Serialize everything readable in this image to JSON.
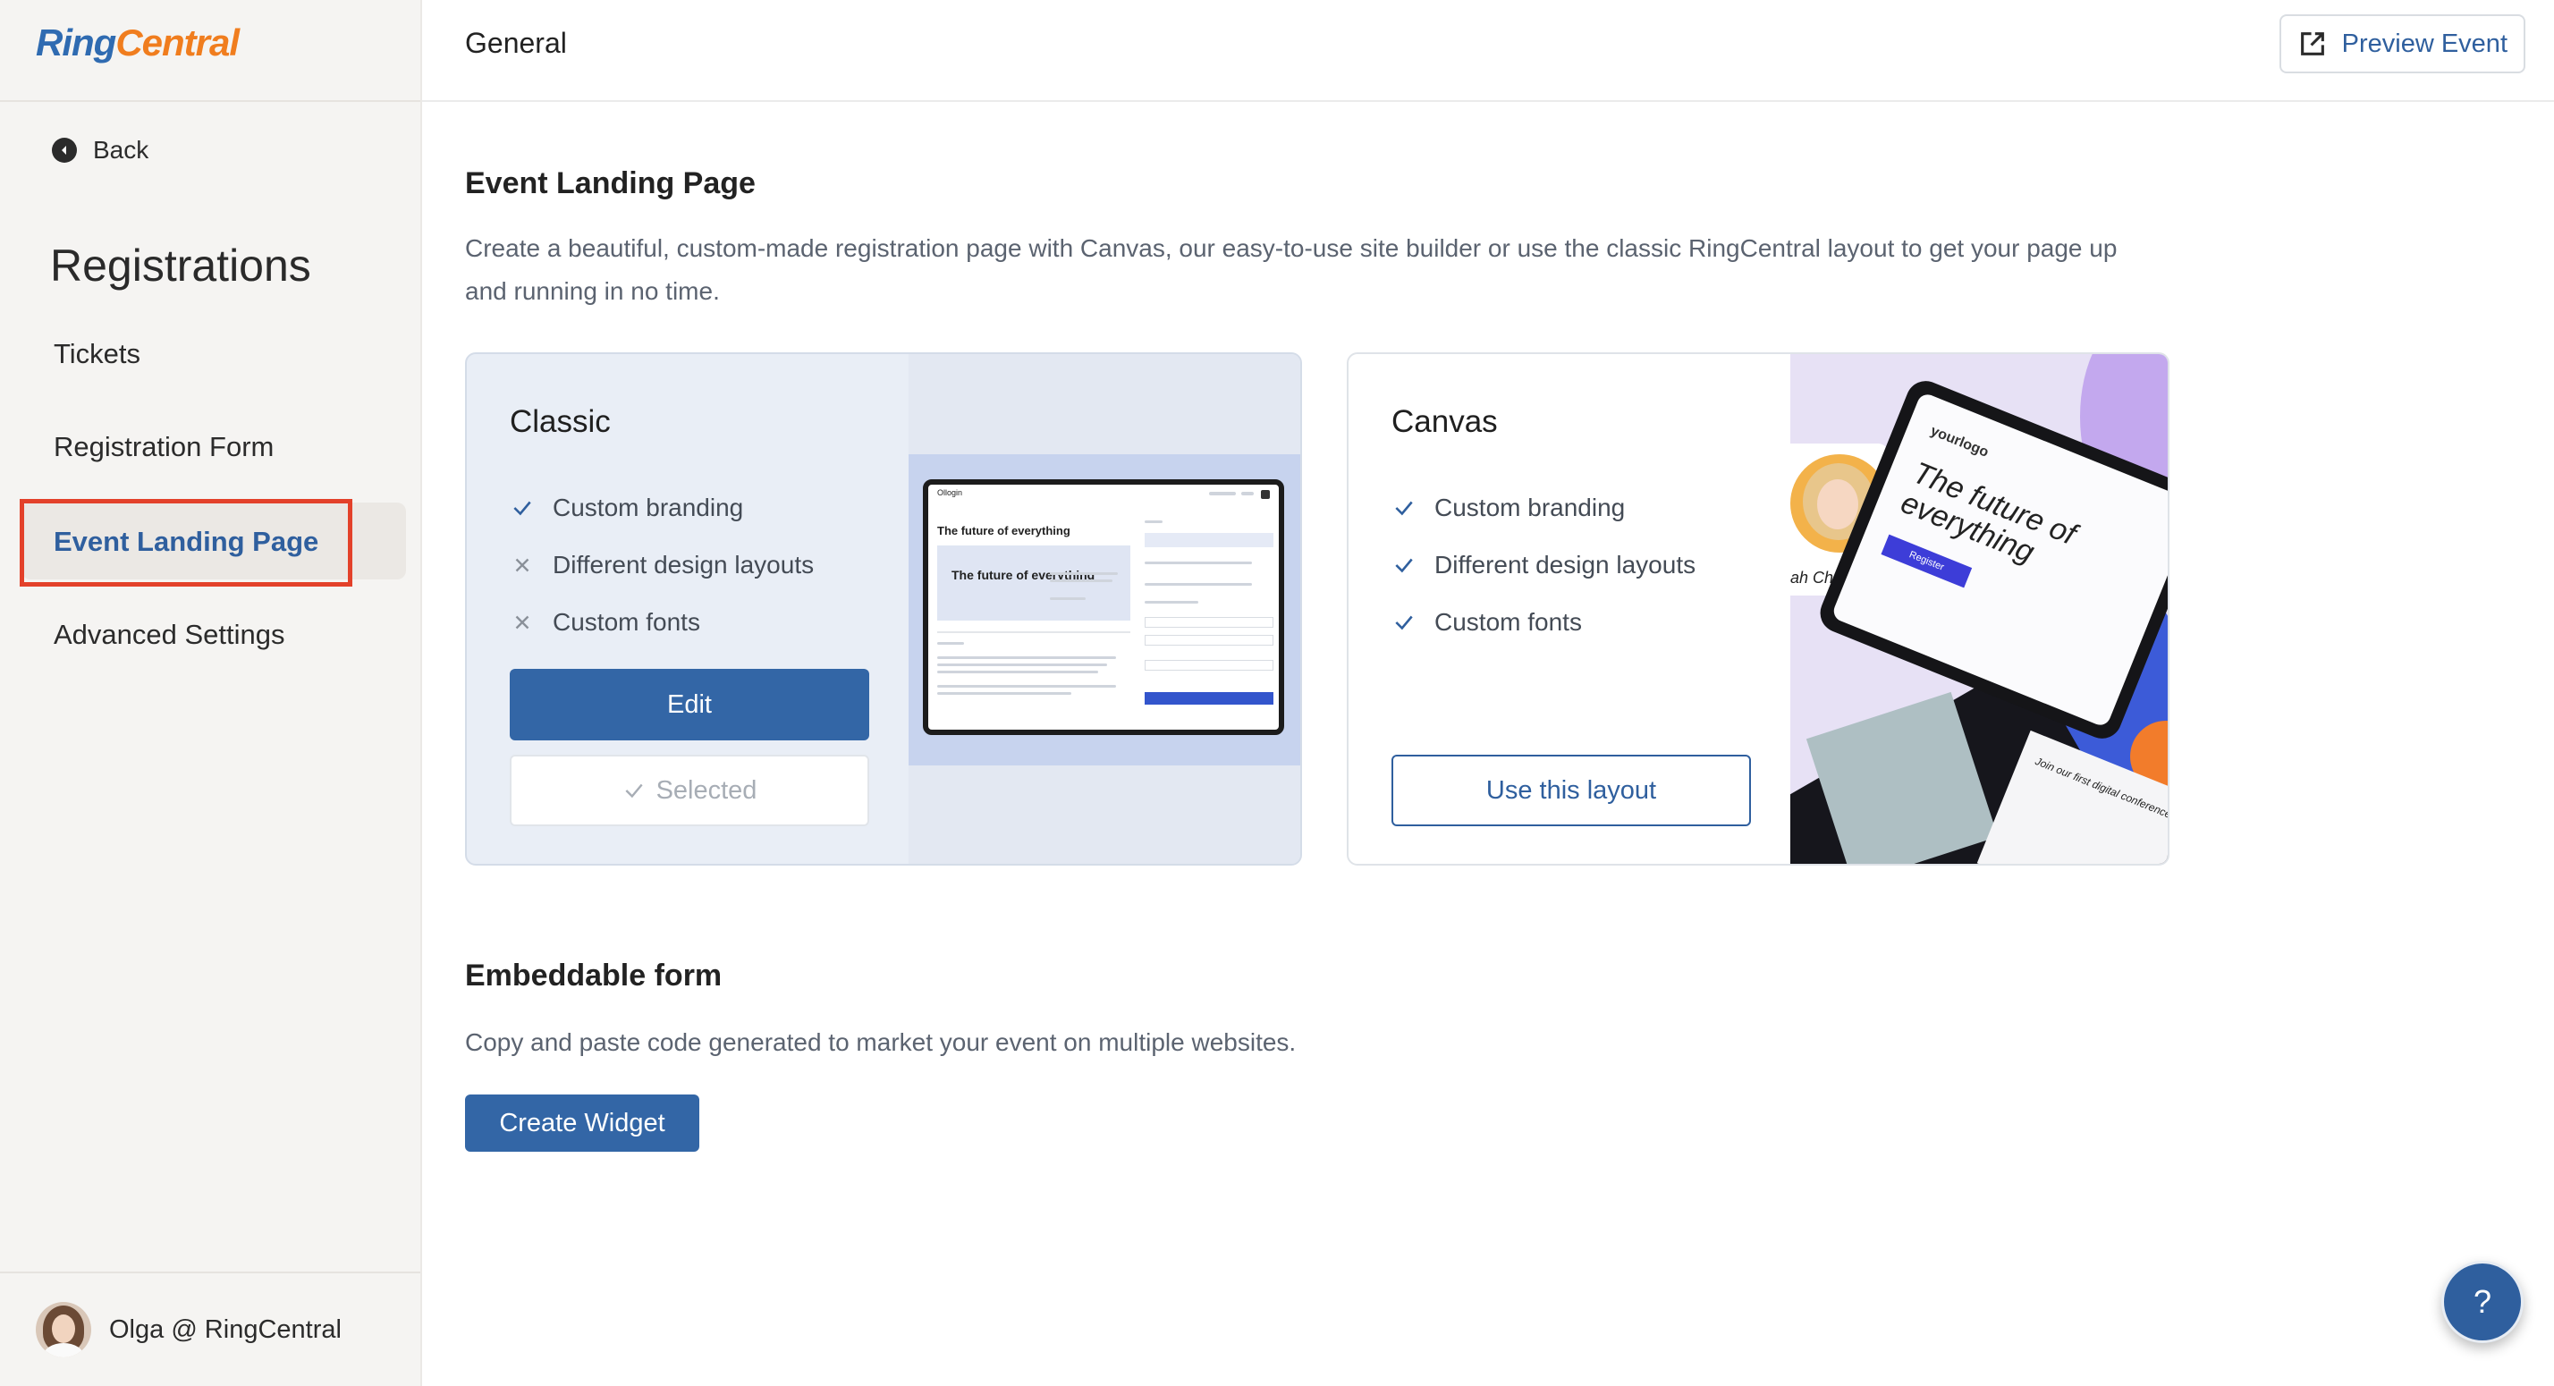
{
  "brand": {
    "logo_part1": "Ring",
    "logo_part2": "Central",
    "color_blue": "#2f6bb1",
    "color_orange": "#f07d1e"
  },
  "sidebar": {
    "back_label": "Back",
    "title": "Registrations",
    "items": [
      {
        "label": "Tickets",
        "active": false
      },
      {
        "label": "Registration Form",
        "active": false
      },
      {
        "label": "Event Landing Page",
        "active": true
      },
      {
        "label": "Advanced Settings",
        "active": false
      }
    ],
    "user_name": "Olga @ RingCentral"
  },
  "header": {
    "title": "General",
    "preview_label": "Preview Event"
  },
  "landing": {
    "title": "Event Landing Page",
    "description": "Create a beautiful, custom-made registration page with Canvas, our easy-to-use site builder or use the classic RingCentral layout to get your page up and running in no time.",
    "classic": {
      "title": "Classic",
      "features": [
        {
          "label": "Custom branding",
          "included": true
        },
        {
          "label": "Different design layouts",
          "included": false
        },
        {
          "label": "Custom fonts",
          "included": false
        }
      ],
      "edit_label": "Edit",
      "selected_label": "Selected",
      "preview": {
        "brand": "Ollogin",
        "heading": "The future of everything",
        "hero": "The future of everything"
      }
    },
    "canvas": {
      "title": "Canvas",
      "features": [
        {
          "label": "Custom branding",
          "included": true
        },
        {
          "label": "Different design layouts",
          "included": true
        },
        {
          "label": "Custom fonts",
          "included": true
        }
      ],
      "use_label": "Use this layout",
      "preview": {
        "logo": "yourlogo",
        "heading": "The future of everything",
        "register": "Register",
        "speaker": "ah Cherry",
        "caption": "Join our first digital conference."
      }
    }
  },
  "embed": {
    "title": "Embeddable form",
    "description": "Copy and paste code generated to market your event on multiple websites.",
    "button_label": "Create Widget"
  },
  "help_label": "?",
  "accent": {
    "primary": "#3366a6",
    "highlight": "#e3412a"
  }
}
